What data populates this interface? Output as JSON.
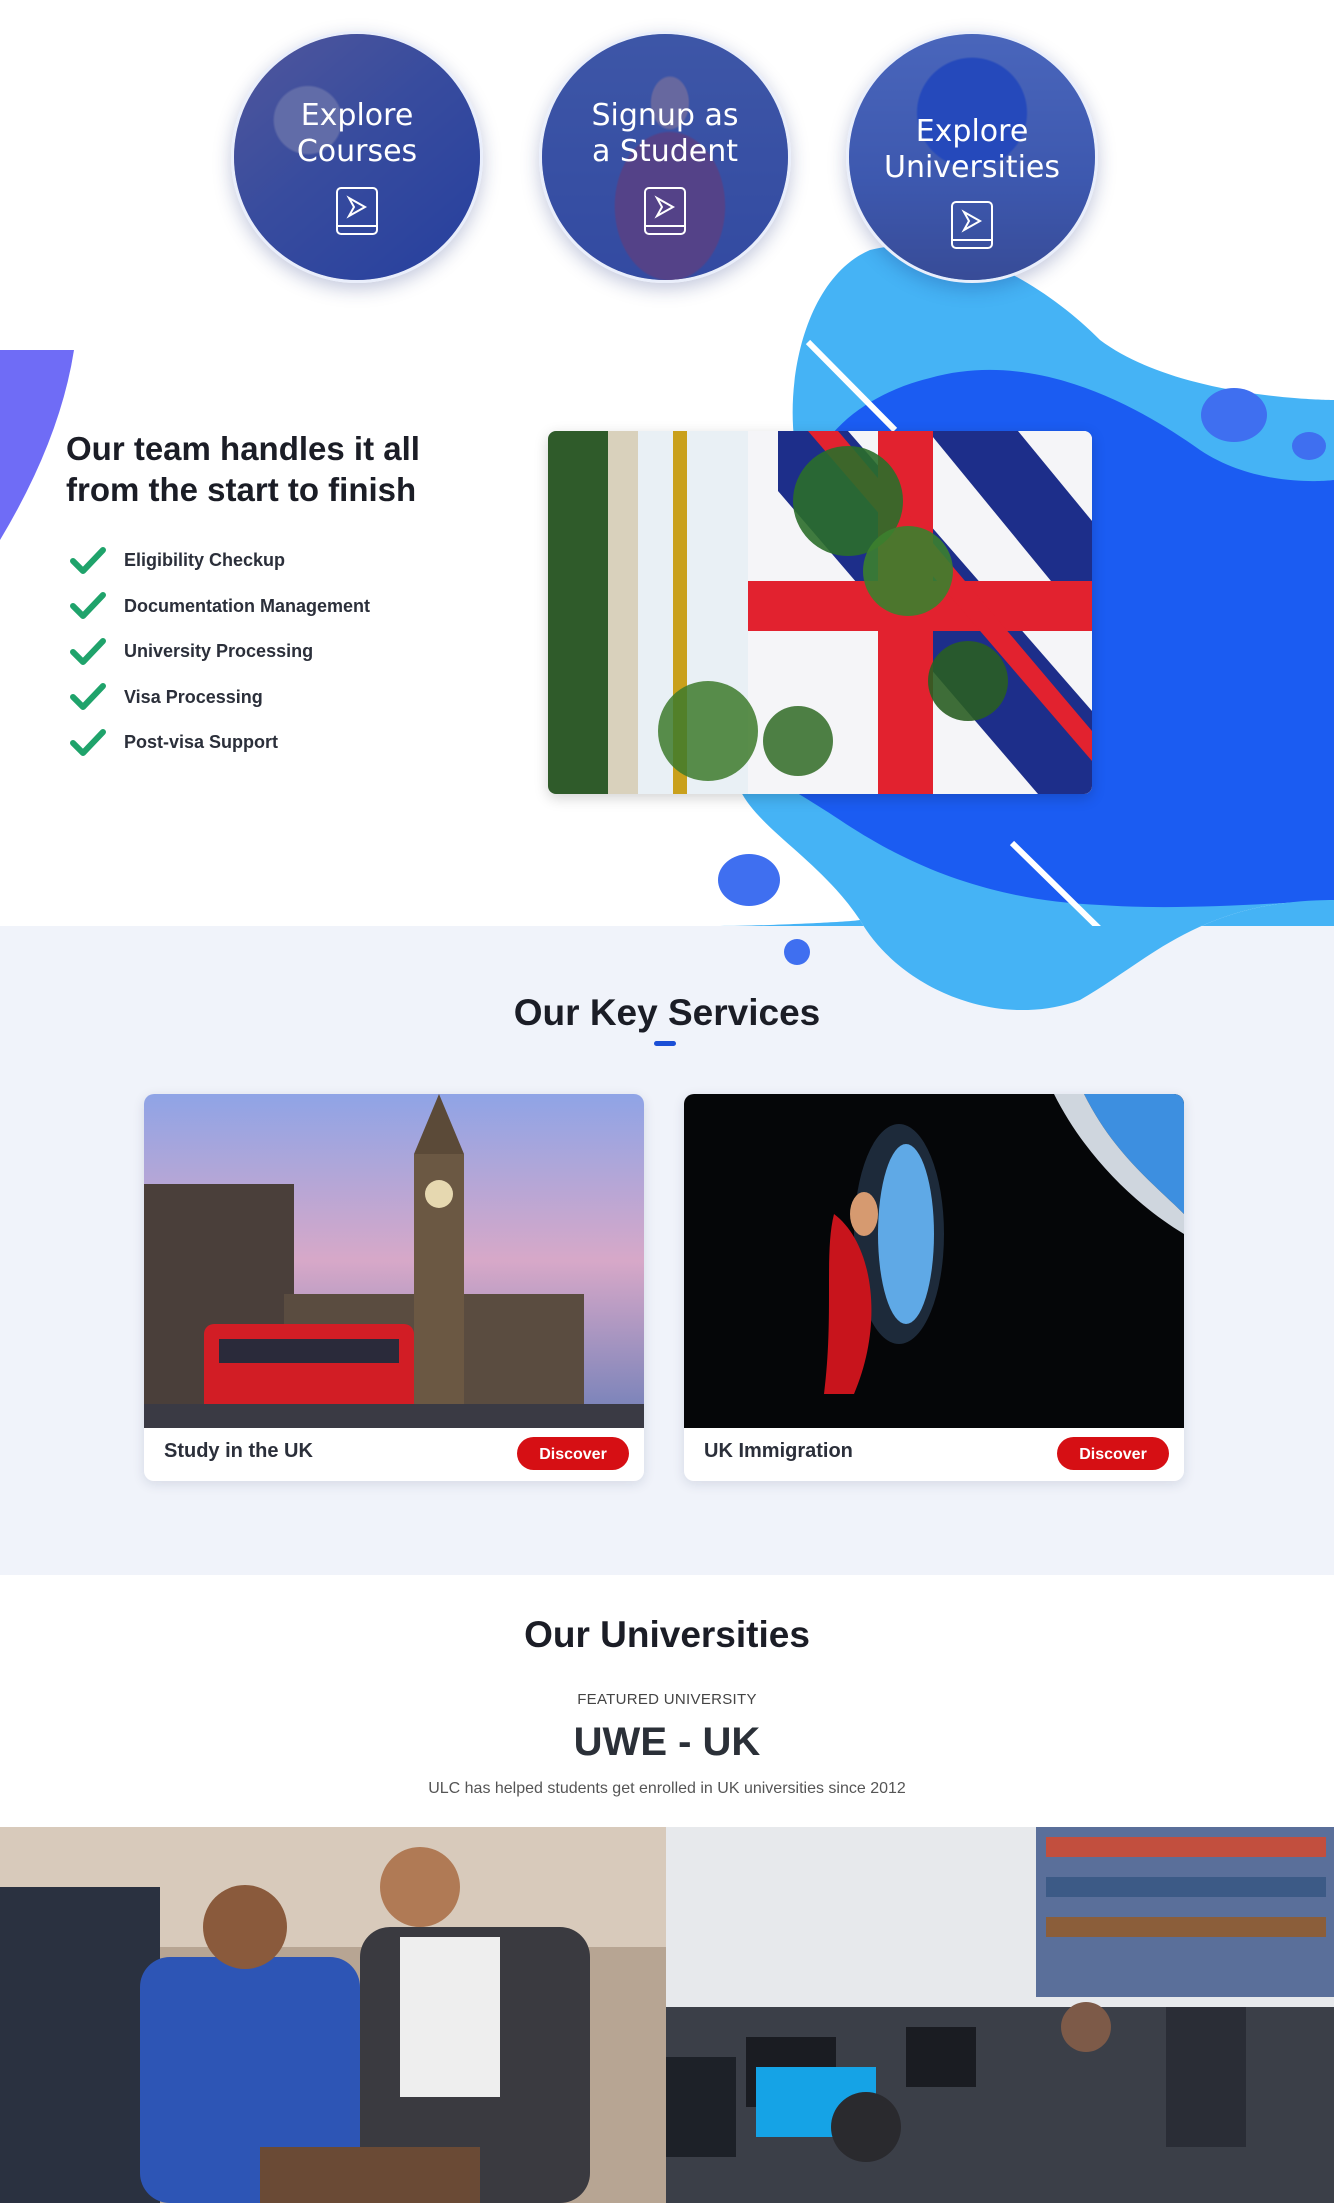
{
  "circles": [
    {
      "line1": "Explore",
      "line2": "Courses",
      "icon": "play-tablet-icon"
    },
    {
      "line1": "Signup as",
      "line2": "a Student",
      "icon": "play-tablet-icon"
    },
    {
      "line1": "Explore",
      "line2": "Universities",
      "icon": "play-tablet-icon"
    }
  ],
  "team": {
    "heading_line1": "Our team handles it all",
    "heading_line2": "from the start to finish",
    "items": [
      "Eligibility Checkup",
      "Documentation Management",
      "University Processing",
      "Visa Processing",
      "Post-visa Support"
    ],
    "check_color": "#1fa36b"
  },
  "services": {
    "title": "Our Key Services",
    "cards": [
      {
        "name": "Study in the UK",
        "button": "Discover"
      },
      {
        "name": "UK Immigration",
        "button": "Discover"
      }
    ]
  },
  "universities": {
    "title": "Our Universities",
    "featured_label": "FEATURED UNIVERSITY",
    "name": "UWE - UK",
    "description": "ULC has helped students get enrolled in UK universities since 2012"
  },
  "colors": {
    "accent_blue": "#1b5cf2",
    "light_blue": "#45b3f5",
    "button_red": "#d60f14",
    "band_bg": "#f0f3fa"
  }
}
